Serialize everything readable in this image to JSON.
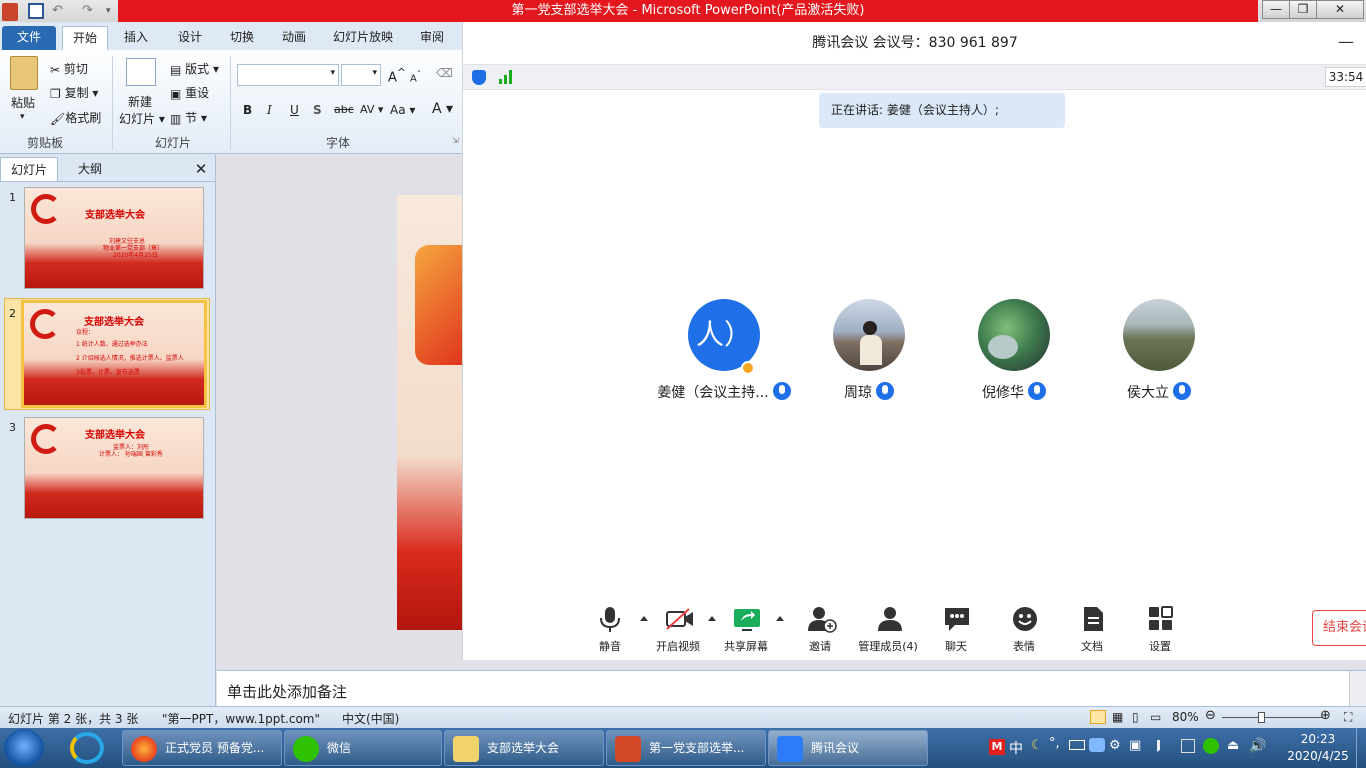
{
  "ppt": {
    "window_title": "第一党支部选举大会 - Microsoft PowerPoint(产品激活失败)",
    "tabs": [
      "文件",
      "开始",
      "插入",
      "设计",
      "切换",
      "动画",
      "幻灯片放映",
      "审阅"
    ],
    "clipboard": {
      "paste": "粘贴",
      "cut": "剪切",
      "copy": "复制",
      "format_painter": "格式刷",
      "group": "剪贴板"
    },
    "slides_group": {
      "new_slide_1": "新建",
      "new_slide_2": "幻灯片",
      "layout": "版式",
      "reset": "重设",
      "section": "节",
      "group": "幻灯片"
    },
    "font_group": {
      "group": "字体",
      "bold": "B",
      "italic": "I",
      "underline": "U",
      "shadow": "S",
      "strike": "abc",
      "spacing": "AV",
      "case": "Aa",
      "color": "A",
      "grow": "A",
      "shrink": "A"
    },
    "panel_tabs": [
      "幻灯片",
      "大纲"
    ],
    "thumbnails": [
      {
        "num": "1",
        "title": "支部选举大会",
        "lines": [
          "刘建文驻支总",
          "物业第一党支部（章）",
          "2020年4月25日"
        ]
      },
      {
        "num": "2",
        "title": "支部选举大会",
        "lines": [
          "议程：",
          "1 统计人数、通过选举办法",
          "2 介绍候选人情况，推选计票人、监票人",
          "3投票、计票、宣布选票"
        ]
      },
      {
        "num": "3",
        "title": "支部选举大会",
        "lines": [
          "监票人：刘彤",
          "计票人： 孙瑞国  曾彩秀"
        ]
      }
    ],
    "notes_placeholder": "单击此处添加备注",
    "status": {
      "slide": "幻灯片 第 2 张，共 3 张",
      "theme": "\"第一PPT，www.1ppt.com\"",
      "lang": "中文(中国)",
      "zoom": "80%"
    }
  },
  "meeting": {
    "title": "腾讯会议 会议号：830 961 897",
    "timer": "33:54",
    "speaking": "正在讲话: 姜健（会议主持人）;",
    "participants": [
      {
        "name": "姜健（会议主持...",
        "avatar_text": "人）"
      },
      {
        "name": "周琼"
      },
      {
        "name": "倪修华"
      },
      {
        "name": "侯大立"
      }
    ],
    "toolbar": [
      "静音",
      "开启视频",
      "共享屏幕",
      "邀请",
      "管理成员(4)",
      "聊天",
      "表情",
      "文档",
      "设置"
    ],
    "end": "结束会议"
  },
  "taskbar": {
    "items": [
      "正式党员 预备党...",
      "微信",
      "支部选举大会",
      "第一党支部选举...",
      "腾讯会议"
    ],
    "time": "20:23",
    "date": "2020/4/25",
    "ime": "中"
  }
}
